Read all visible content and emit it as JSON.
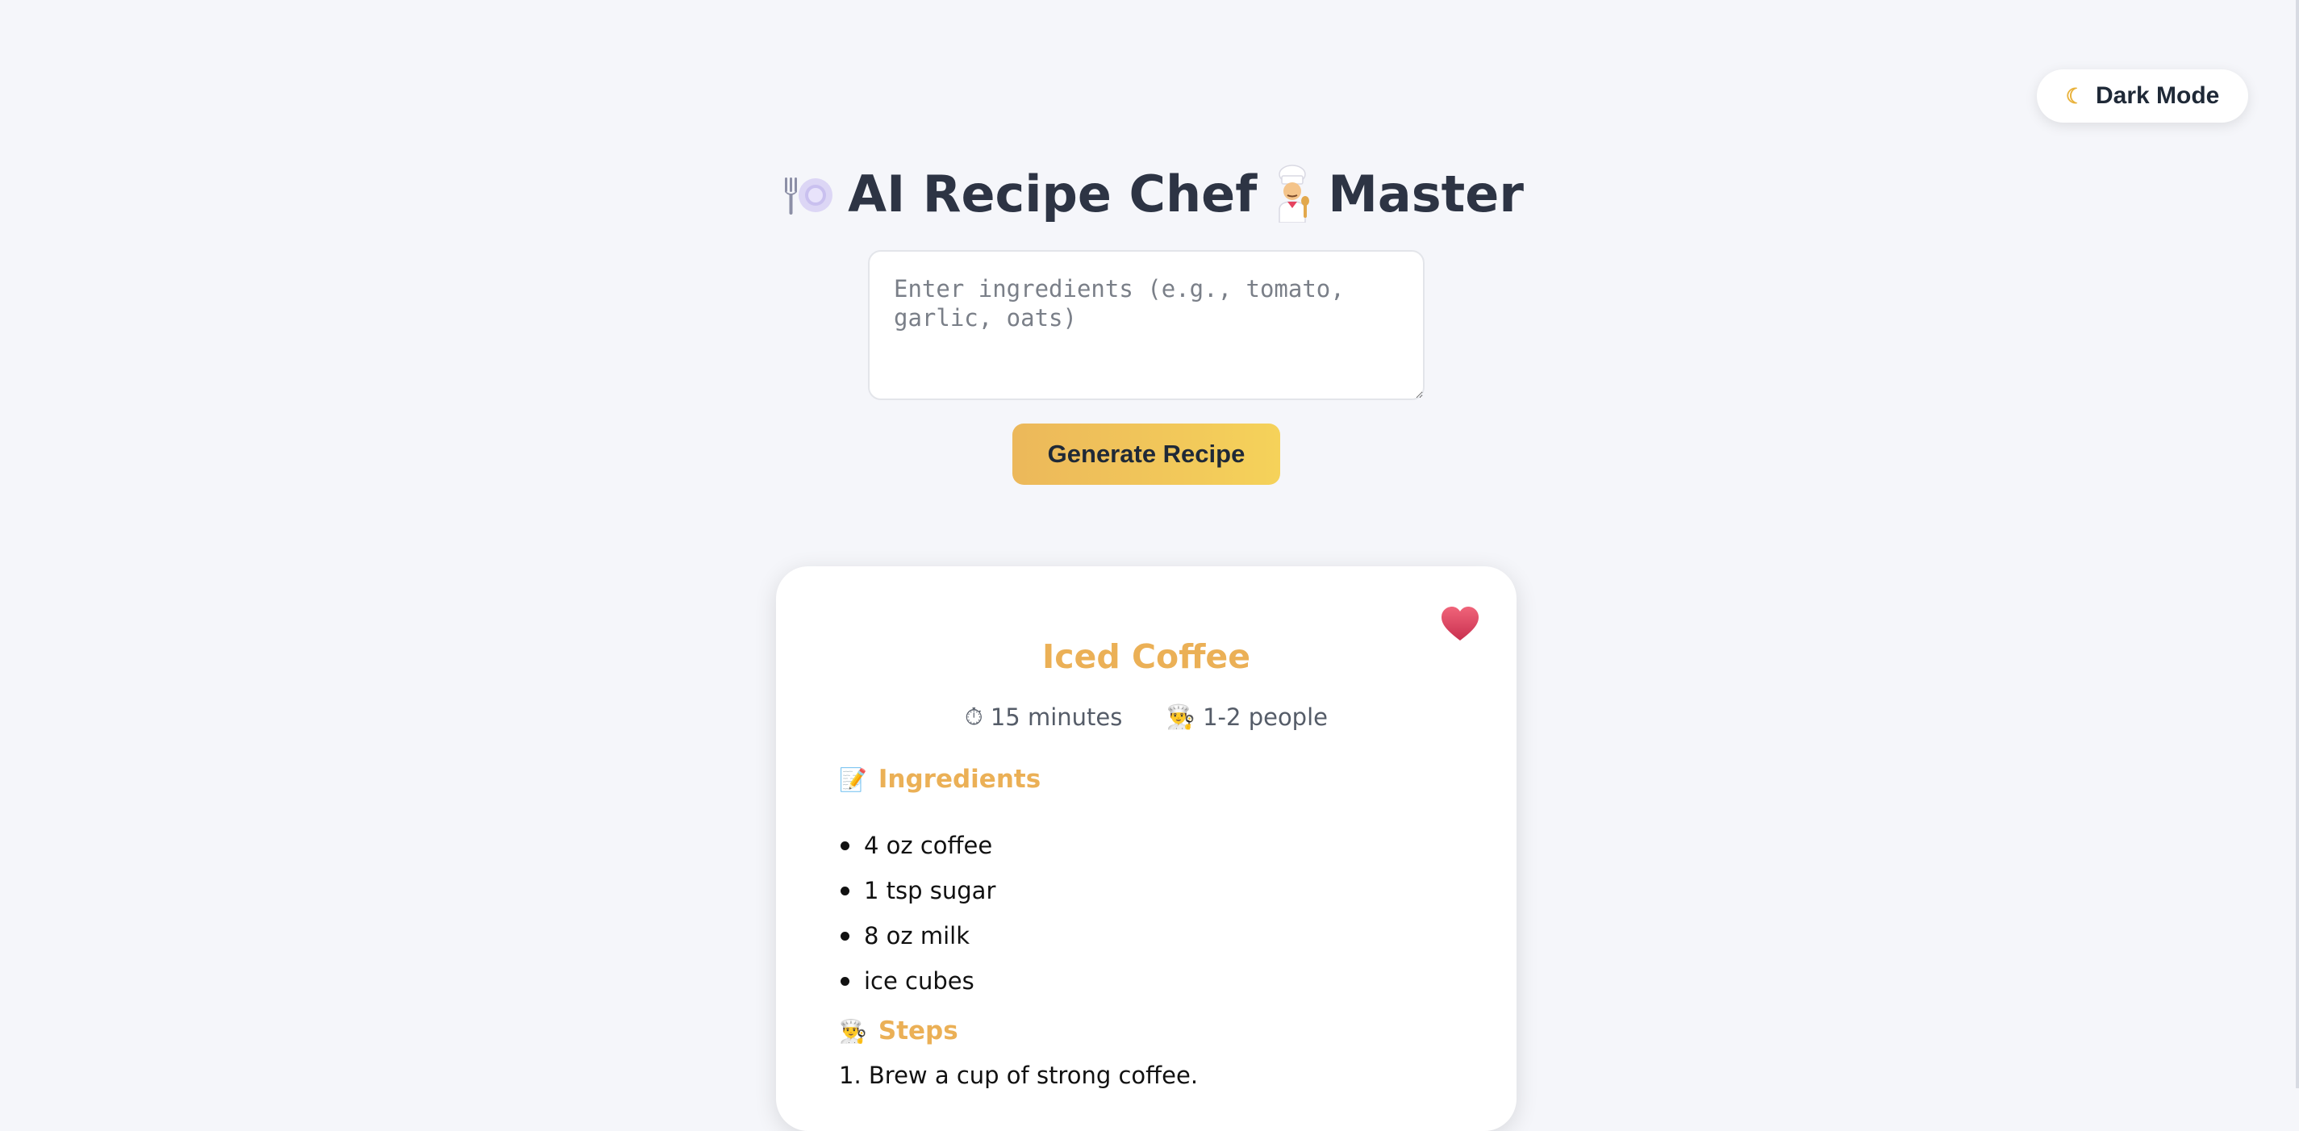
{
  "theme_toggle": {
    "label": "Dark Mode",
    "icon": "moon-icon"
  },
  "header": {
    "title_main": "AI Recipe Chef",
    "title_end": "Master"
  },
  "ingredients_input": {
    "placeholder": "Enter ingredients (e.g., tomato, garlic, oats)",
    "value": ""
  },
  "generate_button": {
    "label": "Generate Recipe"
  },
  "recipe": {
    "title": "Iced Coffee",
    "time": "15 minutes",
    "servings": "1-2 people",
    "ingredients_heading": "Ingredients",
    "ingredients": [
      "4 oz coffee",
      "1 tsp sugar",
      "8 oz milk",
      "ice cubes"
    ],
    "steps_heading": "Steps",
    "steps": [
      "1. Brew a cup of strong coffee."
    ],
    "favorite": true
  },
  "colors": {
    "background": "#f5f6fa",
    "accent": "#ebb056",
    "button_gradient_start": "#ecb85a",
    "button_gradient_end": "#f5d25a",
    "heart": "#e5435f",
    "title": "#2d3444"
  }
}
